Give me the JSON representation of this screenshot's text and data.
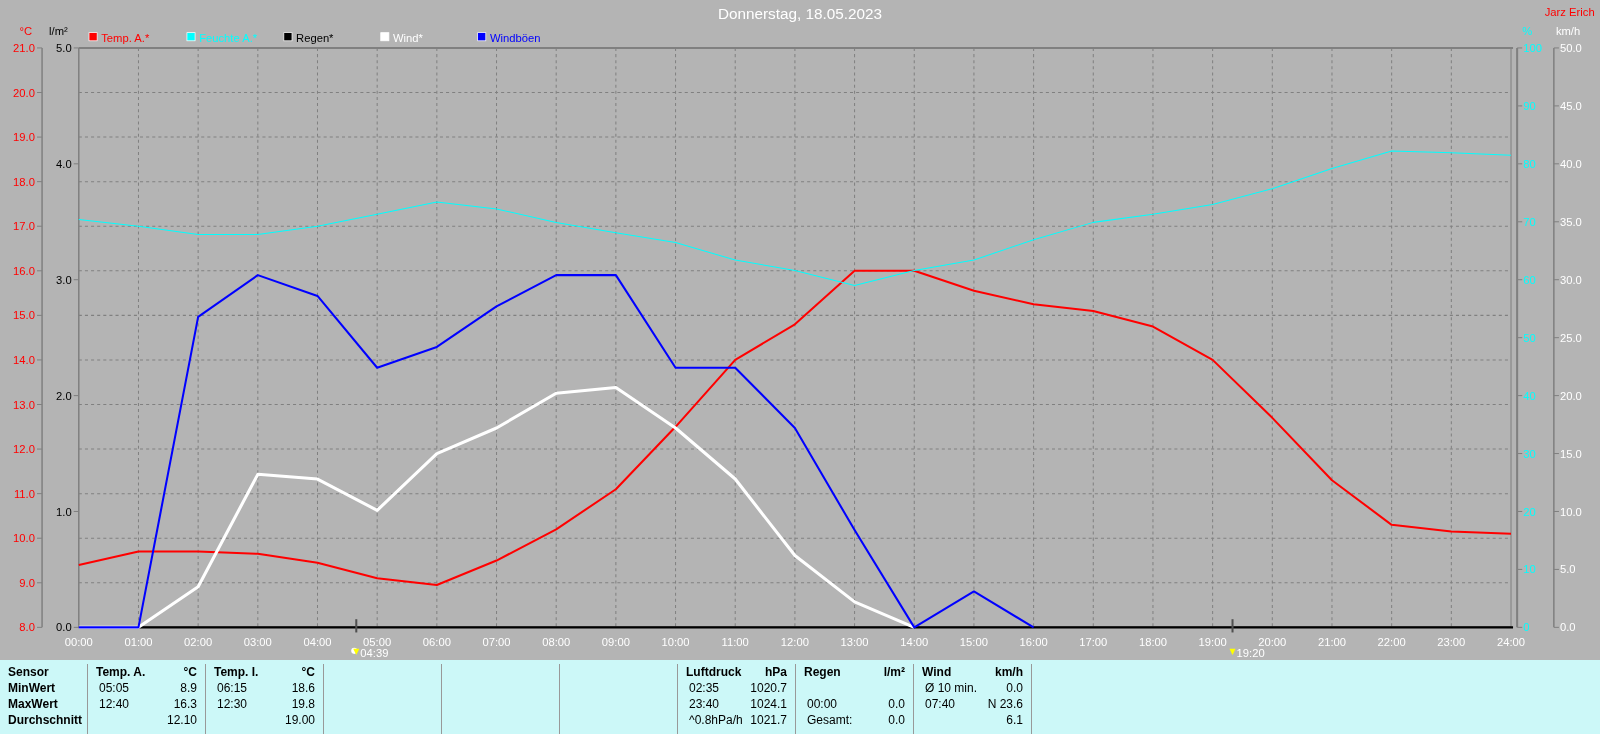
{
  "author": "Jarz Erich",
  "chart": {
    "chart_data": {
      "type": "line",
      "title": "Donnerstag, 18.05.2023",
      "ylabel": "°C",
      "x": [
        "00:00",
        "01:00",
        "02:00",
        "03:00",
        "04:00",
        "05:00",
        "06:00",
        "07:00",
        "08:00",
        "09:00",
        "10:00",
        "11:00",
        "12:00",
        "13:00",
        "14:00",
        "15:00",
        "16:00",
        "17:00",
        "18:00",
        "19:00",
        "20:00",
        "21:00",
        "22:00",
        "23:00",
        "24:00"
      ],
      "ylim": [
        8,
        21
      ],
      "yticks": [
        {
          "value": 21,
          "label": "21.0"
        },
        {
          "value": 20,
          "label": "20.0"
        },
        {
          "value": 19,
          "label": "19.0"
        },
        {
          "value": 18,
          "label": "18.0"
        },
        {
          "value": 17,
          "label": "17.0"
        },
        {
          "value": 16,
          "label": "16.0"
        },
        {
          "value": 15,
          "label": "15.0"
        },
        {
          "value": 14,
          "label": "14.0"
        },
        {
          "value": 13,
          "label": "13.0"
        },
        {
          "value": 12,
          "label": "12.0"
        },
        {
          "value": 11,
          "label": "11.0"
        },
        {
          "value": 10,
          "label": "10.0"
        },
        {
          "value": 9,
          "label": "9.0"
        },
        {
          "value": 8,
          "label": "8.0"
        }
      ],
      "series": [
        {
          "name": "Temp. A.*",
          "color": "#ff0000",
          "values": [
            9.4,
            9.7,
            9.7,
            9.65,
            9.45,
            9.1,
            8.95,
            9.5,
            10.2,
            11.1,
            12.5,
            14.0,
            14.8,
            16.0,
            16.0,
            15.55,
            15.25,
            15.1,
            14.75,
            14.0,
            12.7,
            11.3,
            10.3,
            10.15,
            10.1
          ]
        },
        {
          "name": "Feuchte A.*",
          "color": "#00ffff",
          "axis": "y2",
          "values": [
            70.4,
            69.2,
            67.8,
            67.8,
            69.2,
            71.3,
            73.4,
            72.2,
            69.9,
            68.1,
            66.4,
            63.4,
            61.6,
            59.0,
            61.6,
            63.4,
            66.9,
            69.9,
            71.3,
            73.0,
            75.7,
            79.2,
            82.2,
            81.9,
            81.5
          ]
        },
        {
          "name": "Regen*",
          "color": "#000000",
          "axis": "y3",
          "values": [
            0,
            0,
            0,
            0,
            0,
            0,
            0,
            0,
            0,
            0,
            0,
            0,
            0,
            0,
            0,
            0,
            0,
            0,
            0,
            0,
            0,
            0,
            0,
            0,
            0
          ]
        },
        {
          "name": "Wind*",
          "color": "#ffffff",
          "axis": "y3",
          "values": [
            0,
            0,
            3.5,
            13.2,
            12.8,
            10.1,
            15.0,
            17.2,
            20.2,
            20.7,
            17.2,
            12.8,
            6.2,
            2.2,
            0,
            null,
            null,
            null,
            null,
            null,
            null,
            null,
            null,
            null,
            null
          ]
        },
        {
          "name": "Windböen",
          "color": "#0000ff",
          "axis": "y3",
          "values": [
            0,
            0,
            26.8,
            30.4,
            28.6,
            22.4,
            24.2,
            27.7,
            30.4,
            30.4,
            22.4,
            22.4,
            17.2,
            8.4,
            0,
            3.1,
            0,
            null,
            null,
            null,
            null,
            null,
            null,
            null,
            null
          ]
        }
      ],
      "grid": true,
      "legend": true,
      "y2label": "%",
      "y2lim": [
        0,
        100
      ],
      "y2ticks": [
        100,
        90,
        80,
        70,
        60,
        50,
        40,
        30,
        20,
        10,
        0
      ],
      "y3label": "km/h",
      "y3lim": [
        0,
        50
      ],
      "y3ticks": [
        {
          "value": 50,
          "label": "50.0"
        },
        {
          "value": 45,
          "label": "45.0"
        },
        {
          "value": 40,
          "label": "40.0"
        },
        {
          "value": 35,
          "label": "35.0"
        },
        {
          "value": 30,
          "label": "30.0"
        },
        {
          "value": 25,
          "label": "25.0"
        },
        {
          "value": 20,
          "label": "20.0"
        },
        {
          "value": 15,
          "label": "15.0"
        },
        {
          "value": 10,
          "label": "10.0"
        },
        {
          "value": 5,
          "label": "5.0"
        },
        {
          "value": 0,
          "label": "0.0"
        }
      ],
      "annotations": [
        {
          "text": "04:39"
        },
        {
          "text": "19:20"
        }
      ]
    },
    "rain_axis": {
      "unit": "l/m²",
      "ticks": [
        "5.0",
        "4.0",
        "3.0",
        "2.0",
        "1.0",
        "0.0"
      ]
    }
  },
  "summary_table": {
    "row_labels": [
      "Sensor",
      "MinWert",
      "MaxWert",
      "Durchschnitt"
    ],
    "columns": [
      {
        "kind": "data",
        "name": "Temp. A.",
        "unit": "°C",
        "rows": [
          {
            "time": "05:05",
            "value": "8.9"
          },
          {
            "time": "12:40",
            "value": "16.3"
          },
          {
            "value": "12.10"
          }
        ]
      },
      {
        "kind": "data",
        "name": "Temp. I.",
        "unit": "°C",
        "rows": [
          {
            "time": "06:15",
            "value": "18.6"
          },
          {
            "time": "12:30",
            "value": "19.8"
          },
          {
            "value": "19.00"
          }
        ]
      },
      {
        "kind": "empty"
      },
      {
        "kind": "empty"
      },
      {
        "kind": "empty"
      },
      {
        "kind": "data",
        "name": "Luftdruck",
        "unit": "hPa",
        "rows": [
          {
            "time": "02:35",
            "value": "1020.7"
          },
          {
            "time": "23:40",
            "value": "1024.1"
          },
          {
            "time": "^0.8hPa/h",
            "value": "1021.7"
          }
        ]
      },
      {
        "kind": "data",
        "name": "Regen",
        "unit": "l/m²",
        "rows": [
          {},
          {
            "time": "00:00",
            "value": "0.0"
          },
          {
            "time": "Gesamt:",
            "value": "0.0"
          }
        ]
      },
      {
        "kind": "data",
        "name": "Wind",
        "unit": "km/h",
        "rows": [
          {
            "time": "Ø 10 min.",
            "value": "0.0"
          },
          {
            "time": "07:40",
            "value": "N 23.6"
          },
          {
            "value": "6.1"
          }
        ]
      }
    ]
  }
}
